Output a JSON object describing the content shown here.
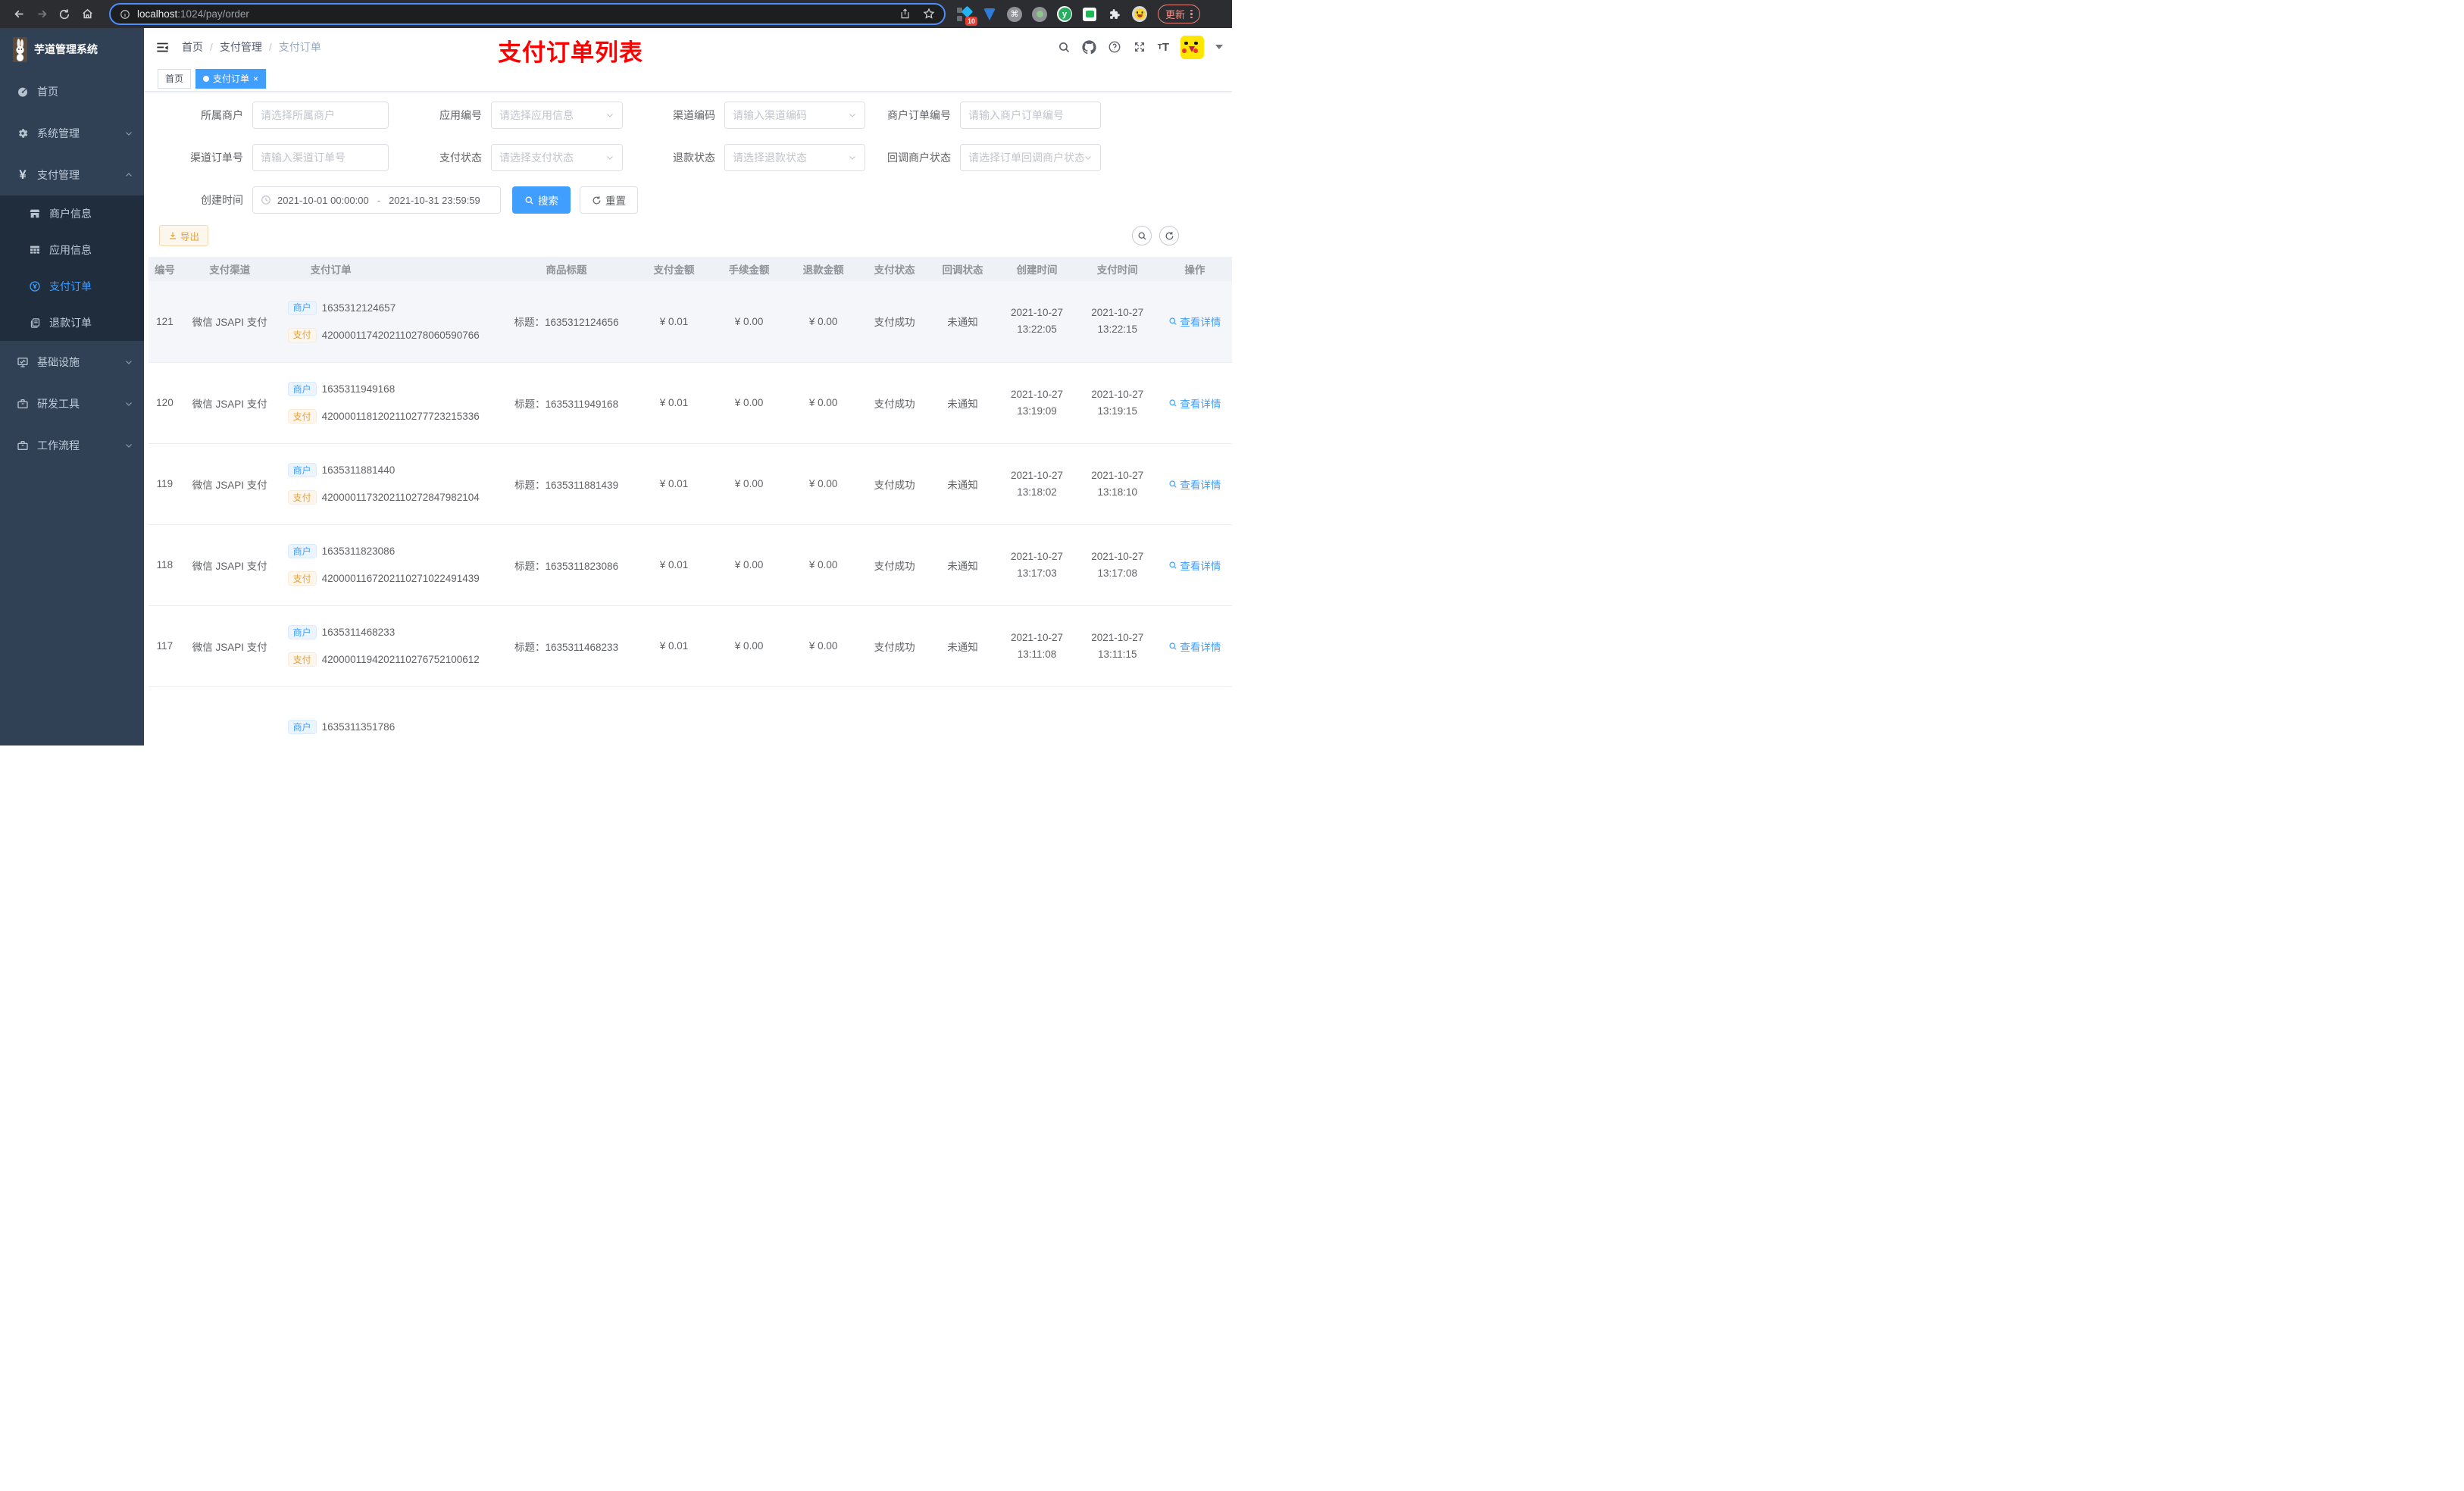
{
  "browser": {
    "url_host": "localhost",
    "url_rest": ":1024/pay/order",
    "extension_badge": "10",
    "extension_y_label": "y",
    "update_label": "更新"
  },
  "app": {
    "title": "芋道管理系统"
  },
  "sidebar": {
    "top": [
      {
        "label": "首页",
        "icon": "dashboard-icon"
      },
      {
        "label": "系统管理",
        "icon": "gear-icon"
      },
      {
        "label": "支付管理",
        "icon": "yen-icon"
      }
    ],
    "sub": [
      {
        "label": "商户信息",
        "icon": "shop-icon"
      },
      {
        "label": "应用信息",
        "icon": "grid-icon"
      },
      {
        "label": "支付订单",
        "icon": "coin-icon"
      },
      {
        "label": "退款订单",
        "icon": "document-icon"
      }
    ],
    "bottom": [
      {
        "label": "基础设施",
        "icon": "monitor-icon"
      },
      {
        "label": "研发工具",
        "icon": "briefcase-icon"
      },
      {
        "label": "工作流程",
        "icon": "briefcase-icon"
      }
    ]
  },
  "header": {
    "breadcrumb": [
      "首页",
      "支付管理",
      "支付订单"
    ],
    "separator": "/",
    "annotation": "支付订单列表"
  },
  "tabs": [
    {
      "label": "首页"
    },
    {
      "label": "支付订单",
      "close": "×"
    }
  ],
  "filters": {
    "merchant": {
      "label": "所属商户",
      "placeholder": "请选择所属商户"
    },
    "app_no": {
      "label": "应用编号",
      "placeholder": "请选择应用信息"
    },
    "channel_code": {
      "label": "渠道编码",
      "placeholder": "请输入渠道编码"
    },
    "merchant_order_no": {
      "label": "商户订单编号",
      "placeholder": "请输入商户订单编号"
    },
    "channel_order_no": {
      "label": "渠道订单号",
      "placeholder": "请输入渠道订单号"
    },
    "pay_status": {
      "label": "支付状态",
      "placeholder": "请选择支付状态"
    },
    "refund_status": {
      "label": "退款状态",
      "placeholder": "请选择退款状态"
    },
    "callback_status": {
      "label": "回调商户状态",
      "placeholder": "请选择订单回调商户状态"
    },
    "create_time": {
      "label": "创建时间",
      "start": "2021-10-01 00:00:00",
      "separator": "-",
      "end": "2021-10-31 23:59:59"
    },
    "search_label": "搜索",
    "reset_label": "重置",
    "export_label": "导出"
  },
  "table": {
    "columns": [
      "编号",
      "支付渠道",
      "支付订单",
      "商品标题",
      "支付金额",
      "手续金额",
      "退款金额",
      "支付状态",
      "回调状态",
      "创建时间",
      "支付时间",
      "操作"
    ],
    "tag_merchant": "商户",
    "tag_pay": "支付",
    "action_label": "查看详情",
    "rows": [
      {
        "id": "121",
        "channel": "微信 JSAPI 支付",
        "merchant_no": "1635312124657",
        "pay_no": "4200001174202110278060590766",
        "title": "标题：1635312124656",
        "amount": "¥ 0.01",
        "fee": "¥ 0.00",
        "refund": "¥ 0.00",
        "status": "支付成功",
        "notify": "未通知",
        "create_date": "2021-10-27",
        "create_time": "13:22:05",
        "pay_date": "2021-10-27",
        "pay_time": "13:22:15"
      },
      {
        "id": "120",
        "channel": "微信 JSAPI 支付",
        "merchant_no": "1635311949168",
        "pay_no": "4200001181202110277723215336",
        "title": "标题：1635311949168",
        "amount": "¥ 0.01",
        "fee": "¥ 0.00",
        "refund": "¥ 0.00",
        "status": "支付成功",
        "notify": "未通知",
        "create_date": "2021-10-27",
        "create_time": "13:19:09",
        "pay_date": "2021-10-27",
        "pay_time": "13:19:15"
      },
      {
        "id": "119",
        "channel": "微信 JSAPI 支付",
        "merchant_no": "1635311881440",
        "pay_no": "4200001173202110272847982104",
        "title": "标题：1635311881439",
        "amount": "¥ 0.01",
        "fee": "¥ 0.00",
        "refund": "¥ 0.00",
        "status": "支付成功",
        "notify": "未通知",
        "create_date": "2021-10-27",
        "create_time": "13:18:02",
        "pay_date": "2021-10-27",
        "pay_time": "13:18:10"
      },
      {
        "id": "118",
        "channel": "微信 JSAPI 支付",
        "merchant_no": "1635311823086",
        "pay_no": "4200001167202110271022491439",
        "title": "标题：1635311823086",
        "amount": "¥ 0.01",
        "fee": "¥ 0.00",
        "refund": "¥ 0.00",
        "status": "支付成功",
        "notify": "未通知",
        "create_date": "2021-10-27",
        "create_time": "13:17:03",
        "pay_date": "2021-10-27",
        "pay_time": "13:17:08"
      },
      {
        "id": "117",
        "channel": "微信 JSAPI 支付",
        "merchant_no": "1635311468233",
        "pay_no": "4200001194202110276752100612",
        "title": "标题：1635311468233",
        "amount": "¥ 0.01",
        "fee": "¥ 0.00",
        "refund": "¥ 0.00",
        "status": "支付成功",
        "notify": "未通知",
        "create_date": "2021-10-27",
        "create_time": "13:11:08",
        "pay_date": "2021-10-27",
        "pay_time": "13:11:15"
      }
    ],
    "partial_row": {
      "merchant_no": "1635311351786"
    }
  },
  "colors": {
    "primary": "#409eff",
    "sidebar": "#304156",
    "submenu": "#1f2d3d",
    "annotation": "#fe0000",
    "warning": "#e6a23c"
  }
}
